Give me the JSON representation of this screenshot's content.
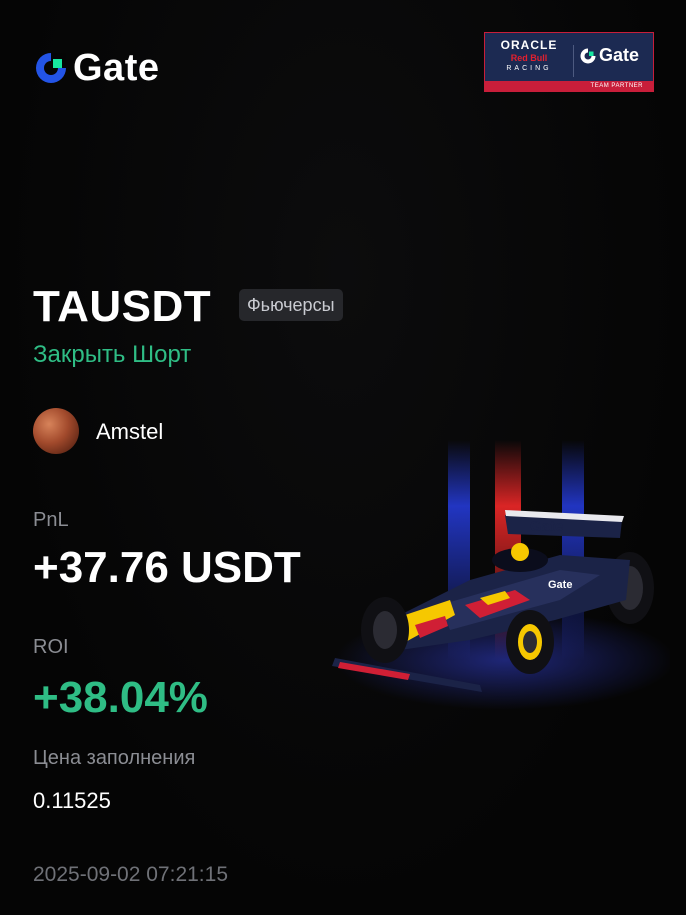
{
  "brand": {
    "name": "Gate",
    "logo_icon": "gate-logo-icon",
    "accent_blue": "#2354e6",
    "accent_green": "#17e6a1"
  },
  "partner": {
    "line1": "ORACLE",
    "line2": "Red Bull",
    "line3": "RACING",
    "gate": "Gate",
    "strip": "TEAM PARTNER"
  },
  "trade": {
    "pair": "TAUSDT",
    "market_tag": "Фьючерсы",
    "direction": "Закрыть Шорт",
    "direction_color": "#2fbd85"
  },
  "user": {
    "name": "Amstel"
  },
  "stats": {
    "pnl_label": "PnL",
    "pnl_value": "+37.76 USDT",
    "roi_label": "ROI",
    "roi_value": "+38.04%",
    "fill_label": "Цена заполнения",
    "fill_value": "0.11525"
  },
  "timestamp": "2025-09-02 07:21:15",
  "artwork": {
    "car_livery": "Gate"
  }
}
